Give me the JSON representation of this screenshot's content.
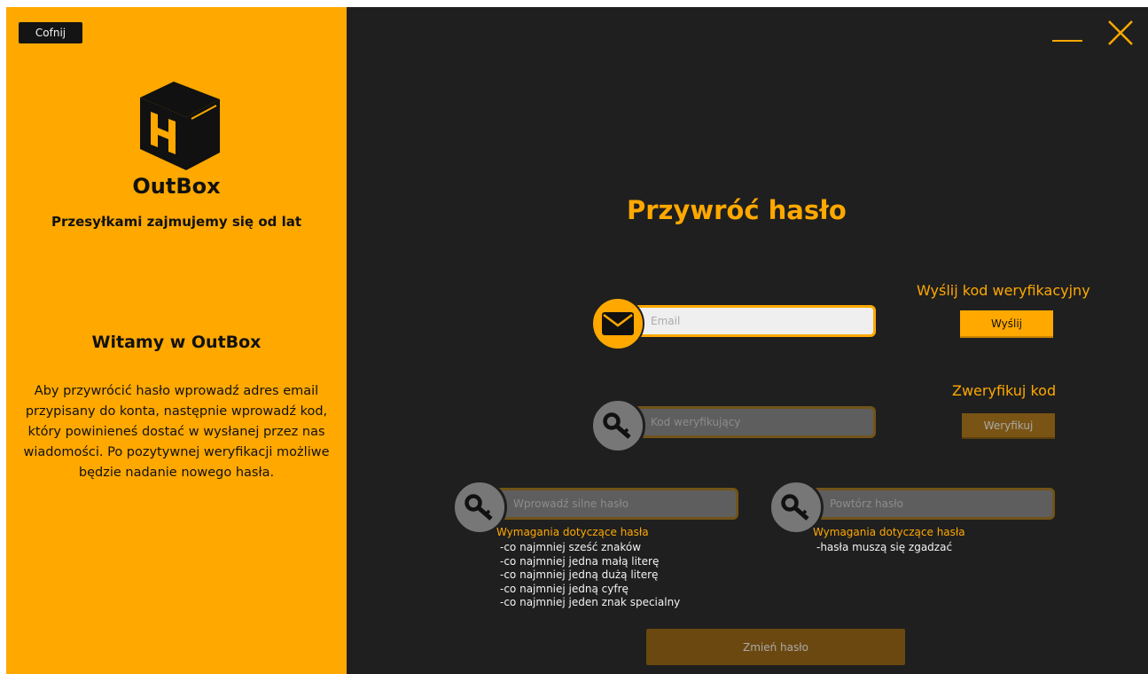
{
  "sidebar": {
    "back_label": "Cofnij",
    "brand": "OutBox",
    "tagline": "Przesyłkami zajmujemy się od lat",
    "welcome": "Witamy w OutBox",
    "description": "Aby przywrócić hasło wprowadź adres email przypisany do konta, następnie wprowadź kod, który powinieneś dostać w wysłanej przez nas wiadomości. Po pozytywnej weryfikacji możliwe będzie nadanie nowego hasła."
  },
  "main": {
    "title": "Przywróć hasło",
    "email": {
      "placeholder": "Email",
      "icon": "envelope-icon"
    },
    "send_code": {
      "label": "Wyślij kod weryfikacyjny",
      "button": "Wyślij"
    },
    "code": {
      "placeholder": "Kod weryfikujący",
      "icon": "key-icon"
    },
    "verify": {
      "label": "Zweryfikuj kod",
      "button": "Weryfikuj"
    },
    "new_password": {
      "placeholder": "Wprowadź silne hasło",
      "icon": "key-icon",
      "requirements_title": "Wymagania dotyczące hasła",
      "requirements": [
        "-co najmniej sześć znaków",
        "-co najmniej jedna małą literę",
        "-co najmniej jedną dużą literę",
        "-co najmniej jedną cyfrę",
        "-co najmniej jeden znak specialny"
      ]
    },
    "repeat_password": {
      "placeholder": "Powtórz hasło",
      "icon": "key-icon",
      "requirements_title": "Wymagania dotyczące hasła",
      "requirements": [
        "-hasła muszą się zgadzać"
      ]
    },
    "submit_label": "Zmień hasło"
  },
  "colors": {
    "accent": "#ffa800",
    "background": "#1f1f1f",
    "dim_accent": "#7a5414"
  }
}
